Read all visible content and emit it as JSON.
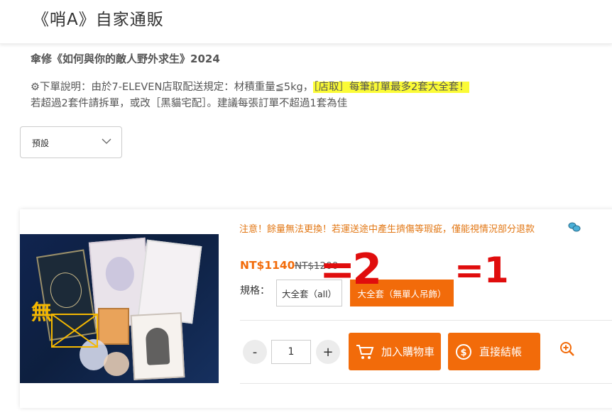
{
  "header": {
    "shop_title": "《哨A》自家通販"
  },
  "product": {
    "name": "傘修《如何與你的敵人野外求生》2024",
    "notice_prefix": "⚙下單說明：由於7-ELEVEN店取配送規定：材積重量≦5kg，",
    "notice_highlight": "［店取］每筆訂單最多2套大全套！",
    "notice_line2": "若超過2套件請拆單，或改［黑貓宅配］。建議每張訂單不超過1套為佳"
  },
  "variant_select": {
    "selected": "預設"
  },
  "card": {
    "warning": "注意！餘量無法更換！若運送途中產生擠傷等瑕疵，僅能視情況部分退款",
    "price": "NT$1140",
    "old_price": "NT$1200",
    "spec_label": "規格：",
    "options": [
      "大全套（all）",
      "大全套（無單人吊飾）"
    ],
    "image_overlay_text": "無",
    "quantity": "1",
    "minus_label": "-",
    "plus_label": "+",
    "add_to_cart_label": "加入購物車",
    "checkout_label": "直接結帳"
  },
  "handwritten_annotations": {
    "left": "=2",
    "right": "=1",
    "color": "#e00d0d"
  },
  "colors": {
    "accent": "#f26b0a",
    "highlight": "#fbfb36",
    "warning_text": "#e27714"
  },
  "icons": [
    "chevron-down-icon",
    "bubbles-icon",
    "cart-icon",
    "dollar-coin-icon",
    "zoom-in-icon"
  ]
}
